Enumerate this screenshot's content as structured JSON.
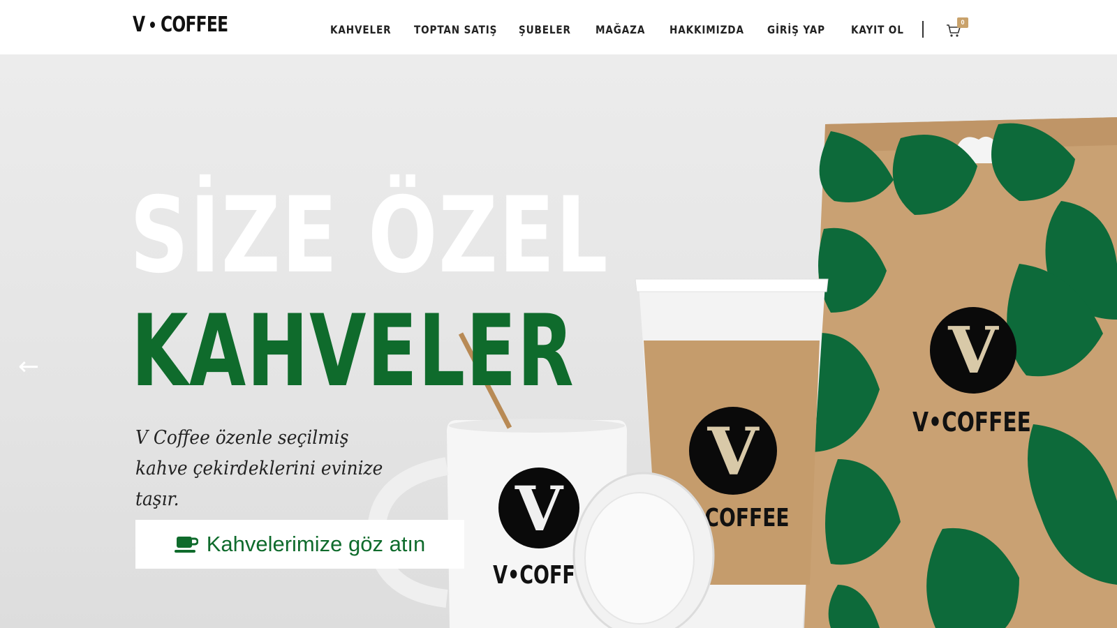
{
  "header": {
    "logo_left": "V",
    "logo_right": "COFFEE",
    "nav": [
      {
        "label": "KAHVELER"
      },
      {
        "label": "TOPTAN SATIŞ"
      },
      {
        "label": "ŞUBELER"
      },
      {
        "label": "MAĞAZA"
      },
      {
        "label": "HAKKIMIZDA"
      },
      {
        "label": "GİRİŞ YAP"
      },
      {
        "label": "KAYIT OL"
      }
    ],
    "cart_count": "0",
    "cart_icon": "cart-icon",
    "badge_color": "#c9a26b"
  },
  "hero": {
    "headline_line1": "SİZE ÖZEL",
    "headline_line2": "KAHVELER",
    "subtext": "V Coffee özenle seçilmiş kahve çekirdeklerini evinize taşır.",
    "cta_label": "Kahvelerimize göz atın",
    "cta_icon": "coffee-cup-icon",
    "prev_arrow": "←",
    "next_arrow": "→",
    "accent_color": "#0f6b2c",
    "product_mark": "V",
    "product_brand": "V•COFFEE",
    "product_brand_cup": "COFFEE",
    "product_brand_mug": "V•COFF"
  }
}
